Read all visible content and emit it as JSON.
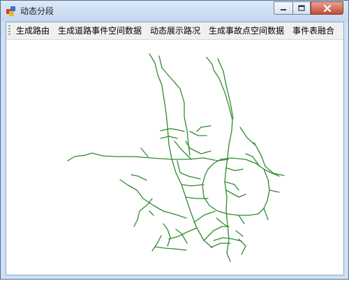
{
  "window": {
    "title": "动态分段"
  },
  "menu": {
    "items": [
      {
        "label": "生成路由"
      },
      {
        "label": "生成道路事件空间数据"
      },
      {
        "label": "动态展示路况"
      },
      {
        "label": "生成事故点空间数据"
      },
      {
        "label": "事件表融合"
      }
    ]
  },
  "map": {
    "road_color": "#2e8b2e"
  },
  "icons": [
    "app-icon",
    "minimize-icon",
    "maximize-icon",
    "close-icon"
  ]
}
